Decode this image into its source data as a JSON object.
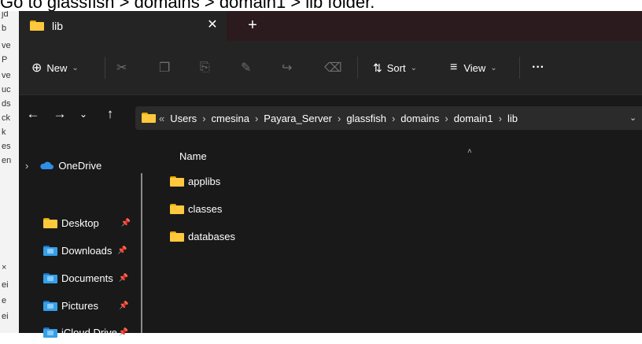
{
  "caption": "Go to glassfish > domains > domain1 > lib folder.",
  "background_doc": [
    "jd",
    "b",
    "ve",
    "P",
    "ve",
    "uc",
    "ds",
    "ck",
    "k",
    "es",
    "en",
    "×",
    "ei",
    "e",
    "ei"
  ],
  "window": {
    "tab": {
      "title": "lib",
      "close_label": "✕",
      "new_tab_label": "+"
    },
    "toolbar": {
      "new_label": "New",
      "new_icon": "⊕",
      "cut_icon": "✂",
      "copy_icon": "❐",
      "paste_icon": "⎘",
      "rename_icon": "✎",
      "share_icon": "↪",
      "delete_icon": "⌫",
      "sort_label": "Sort",
      "sort_icon": "⇅",
      "view_label": "View",
      "view_icon": "≡",
      "more_label": "···",
      "chevron": "⌄"
    },
    "address": {
      "back": "←",
      "forward": "→",
      "recent": "⌄",
      "up": "↑",
      "overflow": "«",
      "separator": "›",
      "crumbs": [
        "Users",
        "cmesina",
        "Payara_Server",
        "glassfish",
        "domains",
        "domain1",
        "lib"
      ],
      "dropdown": "⌄"
    },
    "sidebar": {
      "expand_chevron": "›",
      "pin_glyph": "📌",
      "items": [
        {
          "label": "OneDrive",
          "icon": "cloud-icon",
          "pinned": false
        },
        {
          "label": "Desktop",
          "icon": "folder-icon",
          "pinned": true
        },
        {
          "label": "Downloads",
          "icon": "downloads-folder-icon",
          "pinned": true
        },
        {
          "label": "Documents",
          "icon": "documents-folder-icon",
          "pinned": true
        },
        {
          "label": "Pictures",
          "icon": "pictures-folder-icon",
          "pinned": true
        },
        {
          "label": "iCloud Drive",
          "icon": "icloud-folder-icon",
          "pinned": true
        }
      ]
    },
    "file_list": {
      "column_name": "Name",
      "sort_indicator": "˄",
      "items": [
        "applibs",
        "classes",
        "databases"
      ]
    }
  },
  "colors": {
    "folder": "#ffc83d",
    "window_bg": "#191919",
    "titlebar": "#2b1a1e",
    "accent": "#4cc2ff"
  }
}
